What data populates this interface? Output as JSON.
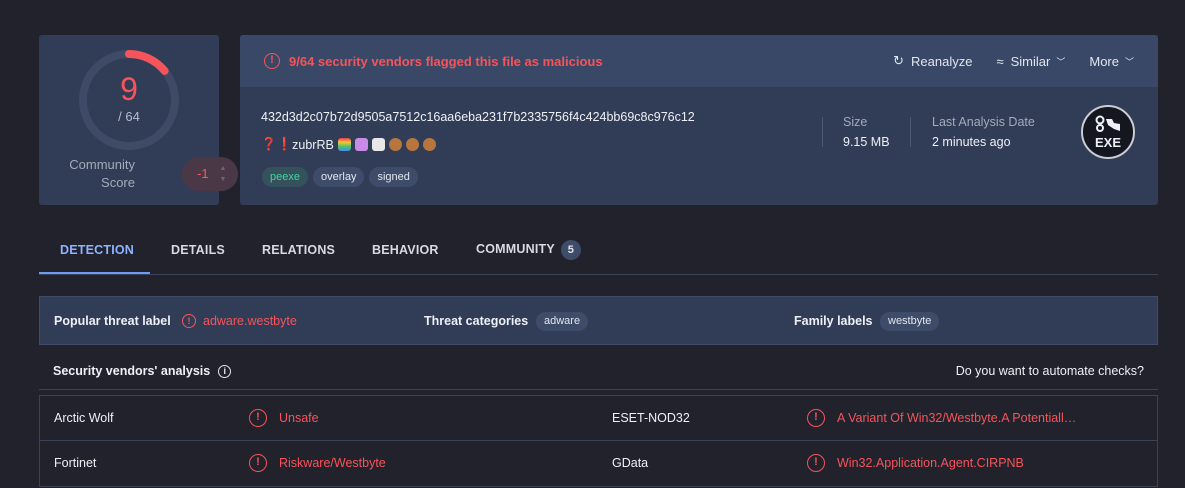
{
  "score": {
    "detections": "9",
    "total": "/ 64",
    "detection_ratio": 0.140625,
    "community_label_line1": "Community",
    "community_label_line2": "Score",
    "community_value": "-1"
  },
  "banner": {
    "alert_text": "9/64 security vendors flagged this file as malicious",
    "reanalyze": "Reanalyze",
    "similar": "Similar",
    "more": "More"
  },
  "file": {
    "hash": "432d3d2c07b72d9505a7512c16aa6eba231f7b2335756f4c424bb69c8c976c12",
    "name_prefix": "❓❗",
    "name": "zubrRB",
    "tags": [
      "peexe",
      "overlay",
      "signed"
    ],
    "size_label": "Size",
    "size_value": "9.15 MB",
    "date_label": "Last Analysis Date",
    "date_value": "2 minutes ago",
    "type_badge": "EXE"
  },
  "tabs": [
    {
      "label": "DETECTION",
      "active": true
    },
    {
      "label": "DETAILS"
    },
    {
      "label": "RELATIONS"
    },
    {
      "label": "BEHAVIOR"
    },
    {
      "label": "COMMUNITY",
      "count": "5"
    }
  ],
  "threat": {
    "popular_label": "Popular threat label",
    "popular_value": "adware.westbyte",
    "categories_label": "Threat categories",
    "categories_value": "adware",
    "family_label": "Family labels",
    "family_value": "westbyte"
  },
  "vendors": {
    "title": "Security vendors' analysis",
    "automate": "Do you want to automate checks?",
    "rows": [
      {
        "left_name": "Arctic Wolf",
        "left_result": "Unsafe",
        "right_name": "ESET-NOD32",
        "right_result": "A Variant Of Win32/Westbyte.A Potentiall…"
      },
      {
        "left_name": "Fortinet",
        "left_result": "Riskware/Westbyte",
        "right_name": "GData",
        "right_result": "Win32.Application.Agent.CIRPNB"
      }
    ]
  },
  "colors": {
    "alert_red": "#f5545a",
    "accent_blue": "#8eb4ff",
    "card_bg": "#313d57",
    "page_bg": "#21222c"
  }
}
